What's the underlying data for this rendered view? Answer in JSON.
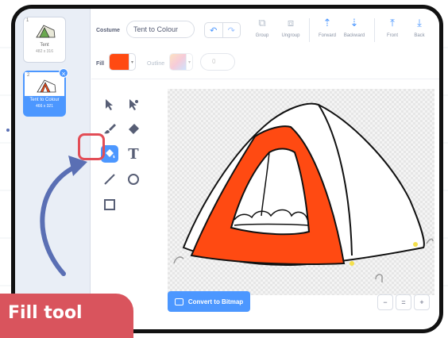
{
  "costumes": [
    {
      "number": "1",
      "name": "Tent",
      "size": "482 x 316",
      "selected": false
    },
    {
      "number": "2",
      "name": "Tent to Colour",
      "size": "466 x 321",
      "selected": true
    }
  ],
  "toolbar": {
    "costume_label": "Costume",
    "costume_name": "Tent to Colour",
    "buttons": [
      "Group",
      "Ungroup",
      "Forward",
      "Backward",
      "Front",
      "Back"
    ]
  },
  "fill": {
    "label": "Fill",
    "color": "#ff4a12",
    "outline_label": "Outline",
    "outline_width": "0"
  },
  "tools": [
    "select-tool",
    "reshape-tool",
    "brush-tool",
    "eraser-tool",
    "fill-tool",
    "text-tool",
    "line-tool",
    "circle-tool",
    "rectangle-tool"
  ],
  "active_tool": "fill-tool",
  "convert_button": "Convert to Bitmap",
  "zoom": {
    "out": "−",
    "reset": "=",
    "in": "+"
  },
  "callout": {
    "text": "Fill tool"
  },
  "colors": {
    "accent": "#4c97ff",
    "highlight": "#e34d56",
    "callout": "#d9545d",
    "arrow": "#5a6fb4"
  }
}
